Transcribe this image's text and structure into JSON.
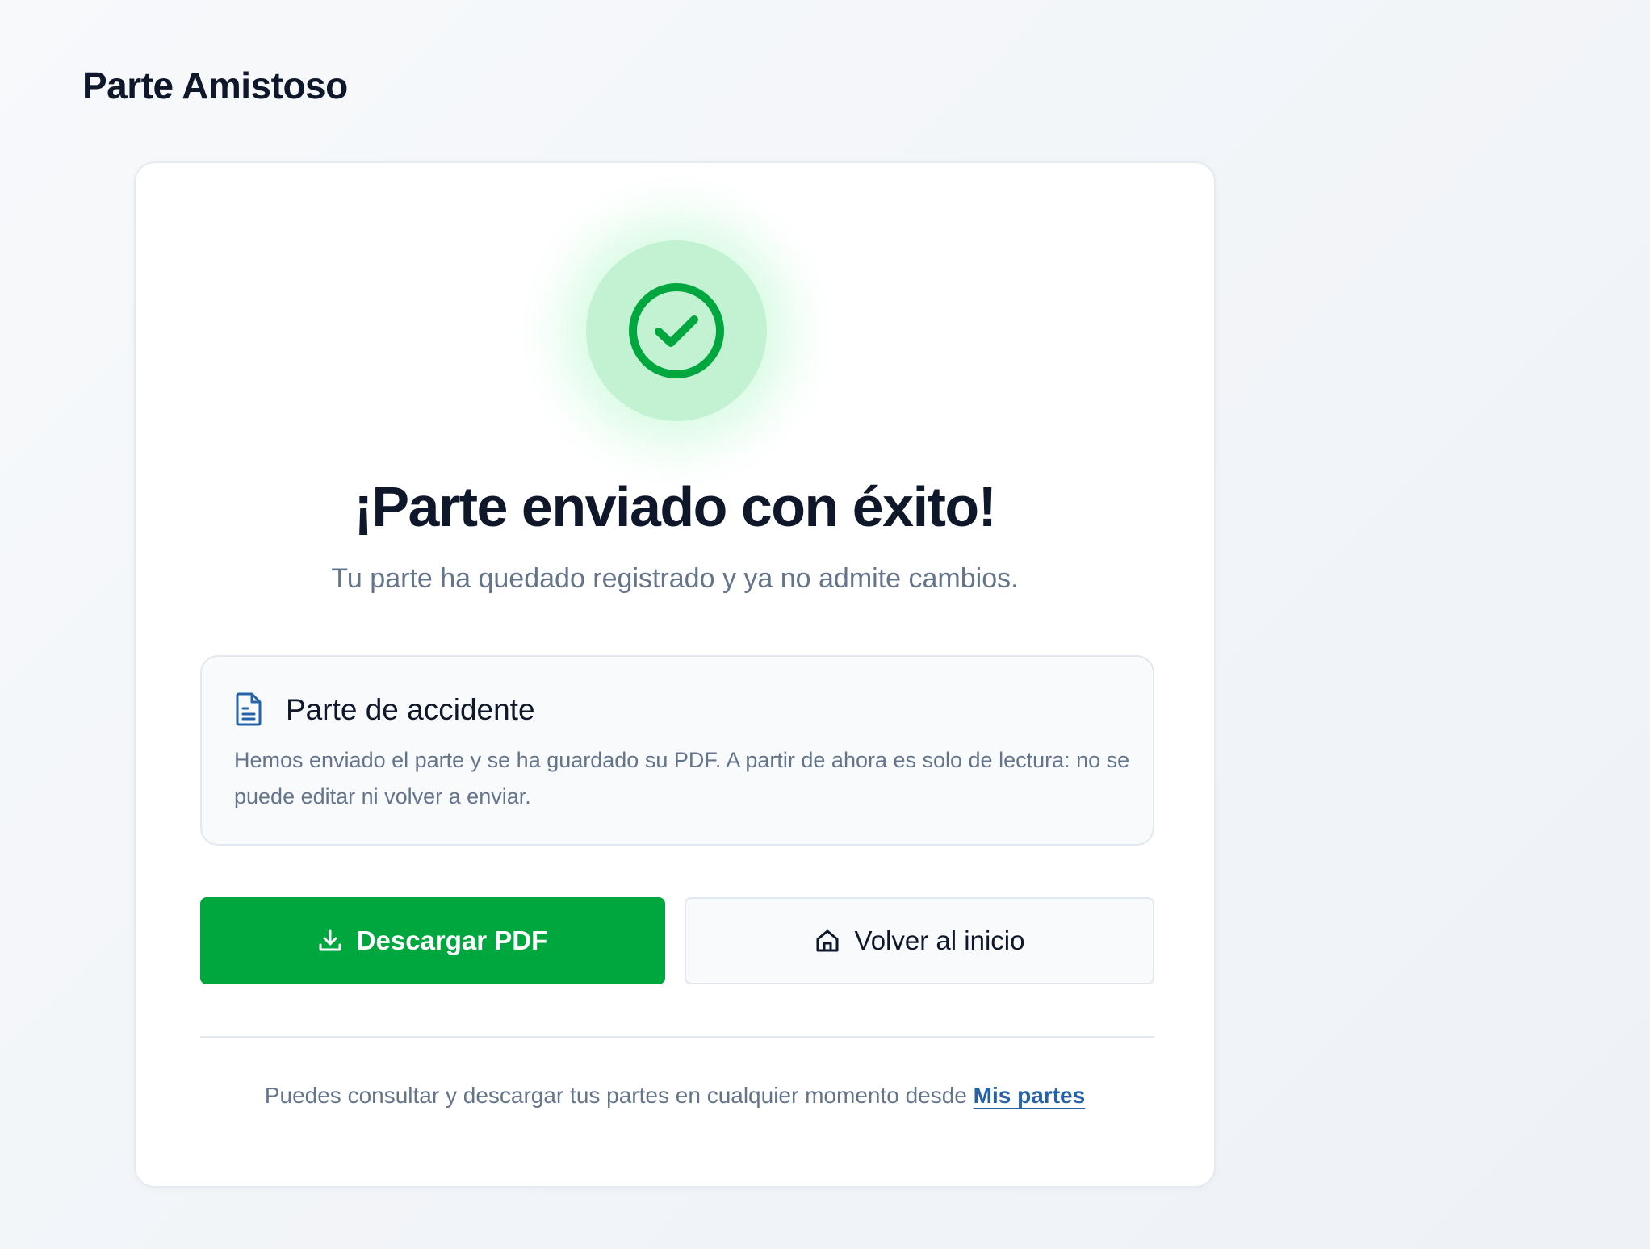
{
  "app": {
    "title": "Parte Amistoso"
  },
  "success": {
    "icon": "check-circle-icon",
    "accent_color": "#00a63e",
    "headline": "¡Parte enviado con éxito!",
    "subtitle": "Tu parte ha quedado registrado y ya no admite cambios."
  },
  "info": {
    "icon": "document-icon",
    "title": "Parte de accidente",
    "text": "Hemos enviado el parte y se ha guardado su PDF. A partir de ahora es solo de lectura: no se puede editar ni volver a enviar."
  },
  "actions": {
    "download": {
      "icon": "download-icon",
      "label": "Descargar PDF"
    },
    "home": {
      "icon": "home-icon",
      "label": "Volver al inicio"
    }
  },
  "footer": {
    "text": "Puedes consultar y descargar tus partes en cualquier momento desde",
    "link_label": "Mis partes"
  }
}
